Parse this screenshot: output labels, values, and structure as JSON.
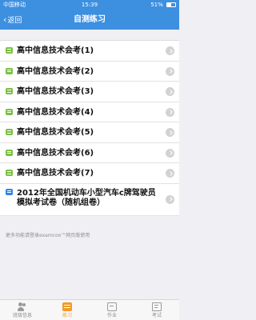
{
  "status_bar": {
    "carrier": "中国移动",
    "time": "15:39",
    "battery_text": "51%",
    "battery_level": 0.51
  },
  "nav": {
    "back_label": "返回",
    "title": "自测练习"
  },
  "items": [
    {
      "label": "高中信息技术会考(1)"
    },
    {
      "label": "高中信息技术会考(2)"
    },
    {
      "label": "高中信息技术会考(3)"
    },
    {
      "label": "高中信息技术会考(4)"
    },
    {
      "label": "高中信息技术会考(5)"
    },
    {
      "label": "高中信息技术会考(6)"
    },
    {
      "label": "高中信息技术会考(7)"
    },
    {
      "label": "2012年全国机动车小型汽车c牌驾驶员模拟考试卷（随机组卷）"
    }
  ],
  "footer_note": "更多功能请登录examcoo™网页版使用",
  "tabs": [
    {
      "label": "班级信息"
    },
    {
      "label": "练习"
    },
    {
      "label": "作业"
    },
    {
      "label": "考试"
    }
  ],
  "colors": {
    "accent": "#3d8fe0",
    "active_tab": "#f09a29",
    "item_icon": "#7bc043",
    "item_icon_alt": "#2f86e4"
  }
}
